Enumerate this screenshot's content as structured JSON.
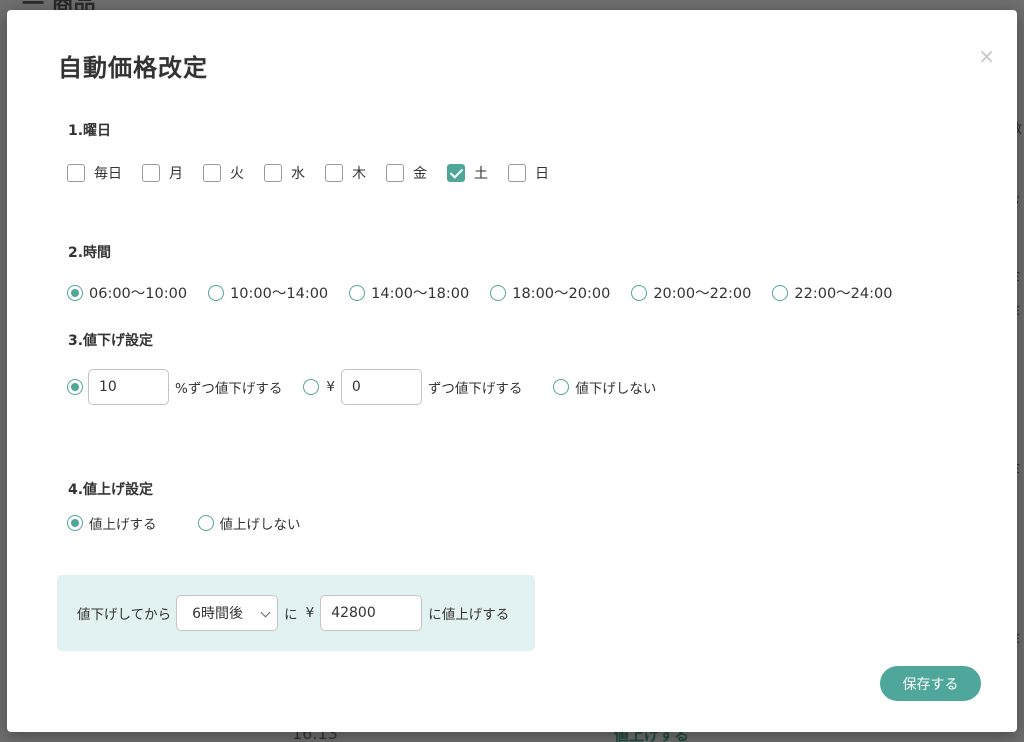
{
  "background": {
    "page_title": "一 商品",
    "bottom_number": "16.13",
    "bottom_link": "値上げする",
    "right_fragments": [
      "数",
      "〕",
      "ゞ",
      "ミ",
      "ミ",
      "ミ",
      "ミ"
    ]
  },
  "modal": {
    "title": "自動価格改定",
    "close_symbol": "×"
  },
  "weekdays": {
    "label": "1.曜日",
    "options": [
      {
        "label": "毎日",
        "checked": false
      },
      {
        "label": "月",
        "checked": false
      },
      {
        "label": "火",
        "checked": false
      },
      {
        "label": "水",
        "checked": false
      },
      {
        "label": "木",
        "checked": false
      },
      {
        "label": "金",
        "checked": false
      },
      {
        "label": "土",
        "checked": true
      },
      {
        "label": "日",
        "checked": false
      }
    ]
  },
  "time": {
    "label": "2.時間",
    "options": [
      {
        "label": "06:00〜10:00",
        "checked": true
      },
      {
        "label": "10:00〜14:00",
        "checked": false
      },
      {
        "label": "14:00〜18:00",
        "checked": false
      },
      {
        "label": "18:00〜20:00",
        "checked": false
      },
      {
        "label": "20:00〜22:00",
        "checked": false
      },
      {
        "label": "22:00〜24:00",
        "checked": false
      }
    ]
  },
  "price_down": {
    "label": "3.値下げ設定",
    "percent_value": "10",
    "percent_suffix": "%ずつ値下げする",
    "yen_symbol": "¥",
    "yen_value": "0",
    "yen_suffix": "ずつ値下げする",
    "none_label": "値下げしない",
    "selected": "percent"
  },
  "price_up": {
    "label": "4.値上げ設定",
    "yes_label": "値上げする",
    "no_label": "値上げしない",
    "selected": "yes"
  },
  "info": {
    "prefix": "値下げしてから",
    "delay_selected": "6時間後",
    "middle": "に",
    "yen_symbol": "¥",
    "price_value": "42800",
    "suffix": "に値上げする"
  },
  "actions": {
    "save_label": "保存する"
  },
  "colors": {
    "accent": "#4fa69a",
    "info_bg": "#e2f1f1"
  }
}
